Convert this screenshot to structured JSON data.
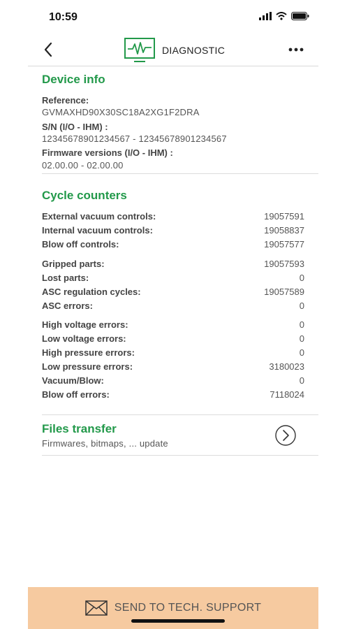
{
  "status_bar": {
    "time": "10:59"
  },
  "nav": {
    "title": "DIAGNOSTIC"
  },
  "device_info": {
    "title": "Device info",
    "reference_label": "Reference:",
    "reference_value": "GVMAXHD90X30SC18A2XG1F2DRA",
    "sn_label": "S/N (I/O - IHM) :",
    "sn_value": "12345678901234567 - 12345678901234567",
    "firmware_label": "Firmware versions (I/O - IHM) :",
    "firmware_value": "02.00.00 - 02.00.00"
  },
  "cycle_counters": {
    "title": "Cycle counters",
    "rows": [
      {
        "label": "External vacuum controls:",
        "value": "19057591"
      },
      {
        "label": "Internal vacuum controls:",
        "value": "19058837"
      },
      {
        "label": "Blow off controls:",
        "value": "19057577"
      },
      {
        "label": "Gripped parts:",
        "value": "19057593"
      },
      {
        "label": "Lost parts:",
        "value": "0"
      },
      {
        "label": "ASC regulation cycles:",
        "value": "19057589"
      },
      {
        "label": "ASC errors:",
        "value": "0"
      },
      {
        "label": "High voltage errors:",
        "value": "0"
      },
      {
        "label": "Low voltage errors:",
        "value": "0"
      },
      {
        "label": "High pressure errors:",
        "value": "0"
      },
      {
        "label": "Low pressure errors:",
        "value": "3180023"
      },
      {
        "label": "Vacuum/Blow:",
        "value": "0"
      },
      {
        "label": "Blow off errors:",
        "value": "7118024"
      }
    ]
  },
  "files_transfer": {
    "title": "Files transfer",
    "subtitle": "Firmwares, bitmaps, ... update"
  },
  "footer": {
    "label": "SEND TO TECH. SUPPORT"
  },
  "colors": {
    "accent": "#22994a",
    "footer_bg": "#f6caa0"
  },
  "icons": [
    "back-chevron-icon",
    "monitor-waveform-icon",
    "more-dots-icon",
    "chevron-right-circle-icon",
    "envelope-icon"
  ]
}
